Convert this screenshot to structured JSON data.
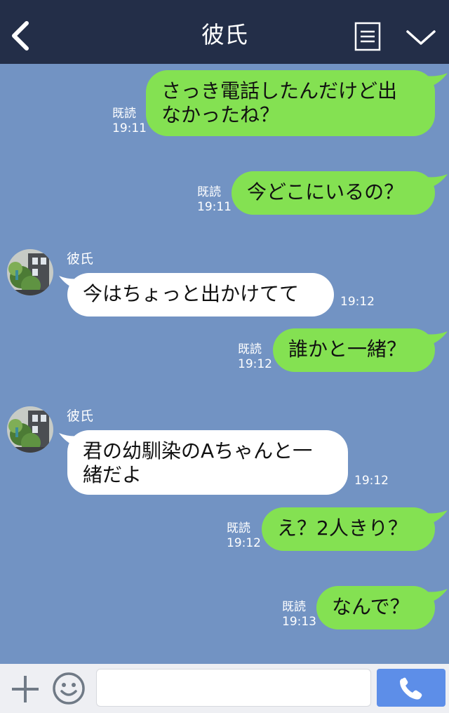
{
  "header": {
    "title": "彼氏"
  },
  "messages": [
    {
      "dir": "out",
      "lines": [
        "さっき電話したんだけど出",
        "なかったね？"
      ],
      "read": "既読",
      "time": "19:11"
    },
    {
      "dir": "out",
      "lines": [
        "今どこにいるの？"
      ],
      "read": "既読",
      "time": "19:11"
    },
    {
      "dir": "in",
      "sender": "彼氏",
      "lines": [
        "今はちょっと出かけてて"
      ],
      "time": "19:12"
    },
    {
      "dir": "out",
      "lines": [
        "誰かと一緒？"
      ],
      "read": "既読",
      "time": "19:12"
    },
    {
      "dir": "in",
      "sender": "彼氏",
      "lines": [
        "君の幼馴染のAちゃんと一",
        "緒だよ"
      ],
      "time": "19:12"
    },
    {
      "dir": "out",
      "lines": [
        "え？2人きり？"
      ],
      "read": "既読",
      "time": "19:12"
    },
    {
      "dir": "out",
      "lines": [
        "なんで？"
      ],
      "read": "既読",
      "time": "19:13"
    }
  ],
  "input": {
    "value": ""
  },
  "colors": {
    "header_bg": "#232e48",
    "chat_bg": "#7293c3",
    "outgoing_bubble": "#84e152",
    "incoming_bubble": "#ffffff",
    "send_button": "#5d8ee8"
  },
  "icons": {
    "back": "chevron-left-icon",
    "menu": "list-icon",
    "collapse": "chevron-down-icon",
    "plus": "plus-icon",
    "emoji": "smiley-icon",
    "call": "phone-icon"
  }
}
